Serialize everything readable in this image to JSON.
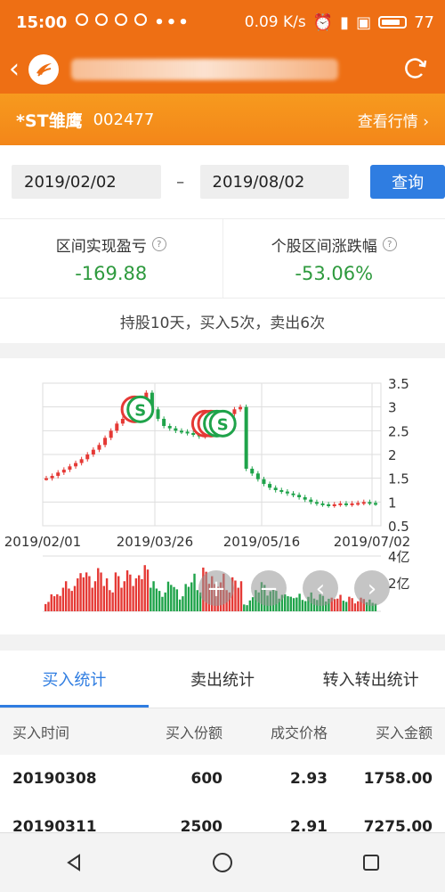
{
  "status_bar": {
    "time": "15:00",
    "network_speed": "0.09 K/s",
    "battery": "77",
    "icons": [
      "chat-icon",
      "yen-icon",
      "weibo-icon",
      "blocked-icon",
      "more-dots-icon",
      "alarm-icon",
      "signal-icon",
      "hd-icon",
      "battery-icon"
    ]
  },
  "navbar": {
    "title_partial": "首词",
    "title_suffix": "析"
  },
  "stock": {
    "name": "*ST雏鹰",
    "code": "002477",
    "quote_link": "查看行情"
  },
  "date_range": {
    "start": "2019/02/02",
    "separator": "–",
    "end": "2019/08/02",
    "query_button": "查询"
  },
  "stats": {
    "pnl_label": "区间实现盈亏",
    "pnl_value": "-169.88",
    "change_label": "个股区间涨跌幅",
    "change_value": "-53.06%"
  },
  "summary": "持股10天，买入5次，卖出6次",
  "chart_data": {
    "type": "candlestick",
    "x_tick_labels": [
      "2019/02/01",
      "2019/03/26",
      "2019/05/16",
      "2019/07/02"
    ],
    "y_tick_labels": [
      "3.5",
      "3",
      "2.5",
      "2",
      "1.5",
      "1",
      "0.5"
    ],
    "ylim": [
      0.5,
      3.5
    ],
    "volume_tick_labels": [
      "4亿",
      "2亿"
    ],
    "price_series": [
      1.5,
      1.55,
      1.62,
      1.68,
      1.75,
      1.82,
      1.9,
      2.0,
      2.1,
      2.2,
      2.35,
      2.5,
      2.65,
      2.75,
      2.85,
      2.95,
      3.05,
      3.3,
      2.95,
      2.75,
      2.6,
      2.55,
      2.5,
      2.48,
      2.45,
      2.42,
      2.38,
      2.45,
      2.55,
      2.7,
      2.78,
      2.85,
      2.95,
      3.0,
      1.7,
      1.6,
      1.48,
      1.38,
      1.3,
      1.25,
      1.22,
      1.18,
      1.15,
      1.1,
      1.05,
      1.0,
      0.97,
      0.95,
      0.93,
      0.95,
      0.97,
      0.95,
      0.97,
      0.98,
      1.0,
      0.98,
      0.97
    ],
    "trade_markers": [
      {
        "type": "buy",
        "x_index": 15,
        "price": 2.95
      },
      {
        "type": "sell",
        "x_index": 16,
        "price": 2.95
      },
      {
        "type": "buy",
        "x_index": 27,
        "price": 2.65
      },
      {
        "type": "buy",
        "x_index": 28,
        "price": 2.65
      },
      {
        "type": "sell",
        "x_index": 29,
        "price": 2.65
      },
      {
        "type": "sell",
        "x_index": 30,
        "price": 2.65
      }
    ],
    "sell_marker_label": "S",
    "colors": {
      "up": "#e53935",
      "down": "#1fa34a",
      "grid": "#dddddd"
    }
  },
  "tabs": [
    "买入统计",
    "卖出统计",
    "转入转出统计"
  ],
  "table": {
    "headers": [
      "买入时间",
      "买入份额",
      "成交价格",
      "买入金额"
    ],
    "rows": [
      [
        "20190308",
        "600",
        "2.93",
        "1758.00"
      ],
      [
        "20190311",
        "2500",
        "2.91",
        "7275.00"
      ]
    ]
  },
  "chart_controls": [
    "zoom-in-icon",
    "zoom-out-icon",
    "scroll-left-icon",
    "scroll-right-icon"
  ],
  "system_nav": [
    "back-triangle-icon",
    "home-circle-icon",
    "recents-square-icon"
  ]
}
